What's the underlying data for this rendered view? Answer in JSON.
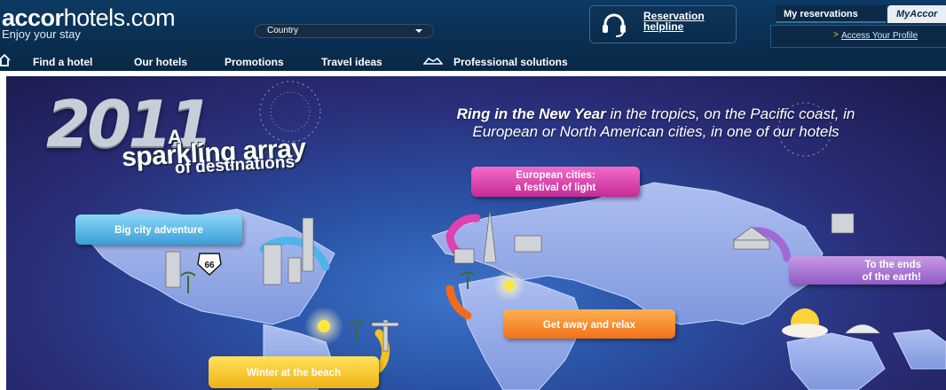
{
  "header": {
    "logo_bold": "accor",
    "logo_rest": "hotels.com",
    "tagline": "Enjoy your stay",
    "country_select": {
      "selected": "Country"
    },
    "reservation": {
      "line1": "Reservation",
      "line2": "helpline",
      "icon": "headset-icon"
    },
    "tabs": {
      "my_reservations": "My reservations",
      "my_accor": "MyAccor"
    },
    "profile_link": "Access Your Profile",
    "nav": [
      "Find a hotel",
      "Our hotels",
      "Promotions",
      "Travel ideas",
      "Professional solutions"
    ]
  },
  "banner": {
    "year": "2011",
    "title_a": "A",
    "title_line1": "sparkling array",
    "title_line2": "of destinations",
    "headline_bold": "Ring in the New Year",
    "headline_rest1": " in the tropics, on the Pacific coast, in",
    "headline_line2": "European or North American cities, in one of our hotels",
    "bubbles": {
      "big_city": "Big city adventure",
      "european_l1": "European cities:",
      "european_l2": "a festival of light",
      "relax": "Get away and relax",
      "beach": "Winter at the beach",
      "ends_l1": "To the ends",
      "ends_l2": "of the earth!"
    },
    "route_sign": "66"
  },
  "colors": {
    "header_bg": "#0a2f52",
    "accent_yellow": "#fbbf3c"
  }
}
